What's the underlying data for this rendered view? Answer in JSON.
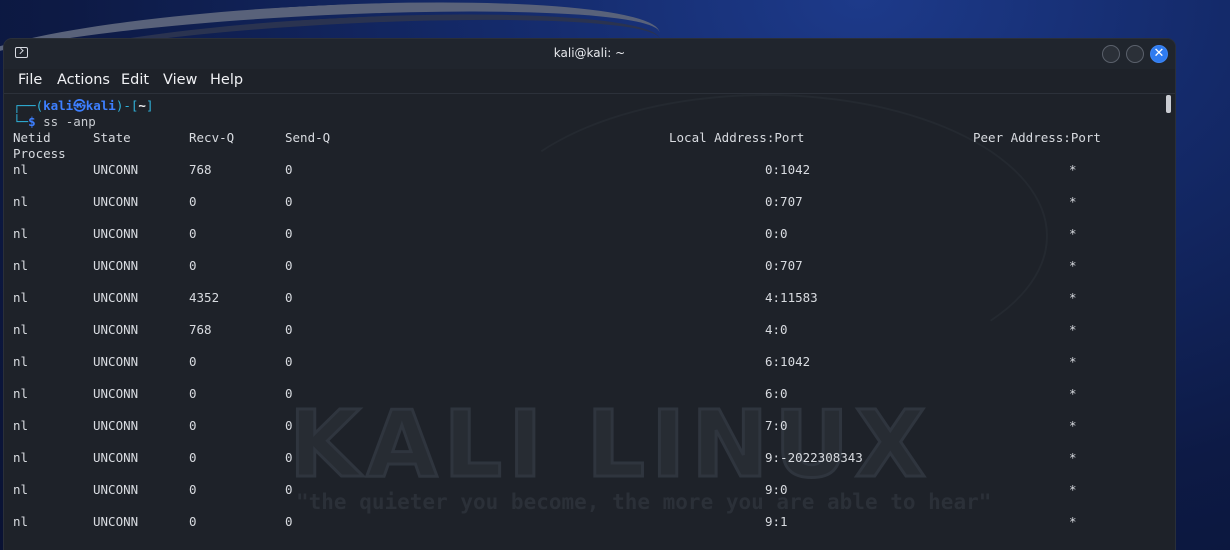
{
  "window": {
    "title": "kali@kali: ~",
    "close_glyph": "✕"
  },
  "menu": [
    "File",
    "Actions",
    "Edit",
    "View",
    "Help"
  ],
  "prompt": {
    "open": "┌──(",
    "user": "kali㉿kali",
    "mid": ")-[",
    "dir": "~",
    "close": "]",
    "line2": "└─",
    "dollar": "$",
    "command": "ss -anp"
  },
  "headers": {
    "netid": "Netid",
    "state": "State",
    "recvq": "Recv-Q",
    "sendq": "Send-Q",
    "local": "Local Address:Port",
    "peer": "Peer Address:Port",
    "process": "Process"
  },
  "rows": [
    {
      "netid": "nl",
      "state": "UNCONN",
      "recvq": "768",
      "sendq": "0",
      "local": "0:1042",
      "peer": "*"
    },
    {
      "netid": "nl",
      "state": "UNCONN",
      "recvq": "0",
      "sendq": "0",
      "local": "0:707",
      "peer": "*"
    },
    {
      "netid": "nl",
      "state": "UNCONN",
      "recvq": "0",
      "sendq": "0",
      "local": "0:0",
      "peer": "*"
    },
    {
      "netid": "nl",
      "state": "UNCONN",
      "recvq": "0",
      "sendq": "0",
      "local": "0:707",
      "peer": "*"
    },
    {
      "netid": "nl",
      "state": "UNCONN",
      "recvq": "4352",
      "sendq": "0",
      "local": "4:11583",
      "peer": "*"
    },
    {
      "netid": "nl",
      "state": "UNCONN",
      "recvq": "768",
      "sendq": "0",
      "local": "4:0",
      "peer": "*"
    },
    {
      "netid": "nl",
      "state": "UNCONN",
      "recvq": "0",
      "sendq": "0",
      "local": "6:1042",
      "peer": "*"
    },
    {
      "netid": "nl",
      "state": "UNCONN",
      "recvq": "0",
      "sendq": "0",
      "local": "6:0",
      "peer": "*"
    },
    {
      "netid": "nl",
      "state": "UNCONN",
      "recvq": "0",
      "sendq": "0",
      "local": "7:0",
      "peer": "*"
    },
    {
      "netid": "nl",
      "state": "UNCONN",
      "recvq": "0",
      "sendq": "0",
      "local": "9:-2022308343",
      "peer": "*"
    },
    {
      "netid": "nl",
      "state": "UNCONN",
      "recvq": "0",
      "sendq": "0",
      "local": "9:0",
      "peer": "*"
    },
    {
      "netid": "nl",
      "state": "UNCONN",
      "recvq": "0",
      "sendq": "0",
      "local": "9:1",
      "peer": "*"
    }
  ],
  "background": {
    "watermark": "KALI LINUX",
    "slogan": "\"the quieter you become, the more you are able to hear\""
  },
  "colors": {
    "terminal_bg": "#1e2229",
    "prompt_frame": "#2fb0d8",
    "prompt_user": "#3d7fff",
    "close_button": "#2f7bf0"
  }
}
